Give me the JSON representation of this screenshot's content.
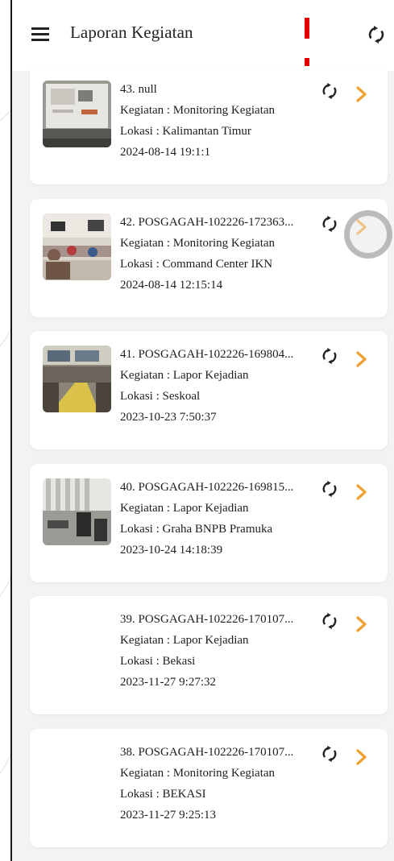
{
  "app_bar": {
    "title": "Laporan Kegiatan"
  },
  "reports": [
    {
      "title": "43. null",
      "kegiatan": "Kegiatan : Monitoring Kegiatan",
      "lokasi": "Lokasi : Kalimantan Timur",
      "tanggal": "2024-08-14 19:1:1",
      "thumb": "monitor-photo"
    },
    {
      "title": "42. POSGAGAH-102226-172363...",
      "kegiatan": "Kegiatan : Monitoring Kegiatan",
      "lokasi": "Lokasi : Command Center IKN",
      "tanggal": "2024-08-14 12:15:14",
      "thumb": "meeting-room-photo"
    },
    {
      "title": "41. POSGAGAH-102226-169804...",
      "kegiatan": "Kegiatan : Lapor Kejadian",
      "lokasi": "Lokasi : Seskoal",
      "tanggal": "2023-10-23 7:50:37",
      "thumb": "command-room-photo"
    },
    {
      "title": "40. POSGAGAH-102226-169815...",
      "kegiatan": "Kegiatan : Lapor Kejadian",
      "lokasi": "Lokasi : Graha BNPB Pramuka",
      "tanggal": "2023-10-24 14:18:39",
      "thumb": "office-photo"
    },
    {
      "title": "39. POSGAGAH-102226-170107...",
      "kegiatan": "Kegiatan : Lapor Kejadian",
      "lokasi": "Lokasi : Bekasi",
      "tanggal": "2023-11-27 9:27:32",
      "thumb": ""
    },
    {
      "title": "38. POSGAGAH-102226-170107...",
      "kegiatan": "Kegiatan : Monitoring Kegiatan",
      "lokasi": "Lokasi : BEKASI",
      "tanggal": "2023-11-27 9:25:13",
      "thumb": ""
    }
  ],
  "colors": {
    "accent": "#f0a030",
    "highlight": "#e00000",
    "card": "#ffffff",
    "background": "#f3f3f3"
  },
  "icons": {
    "menu": "hamburger-icon",
    "sync": "sync-icon",
    "open": "chevron-right-icon"
  }
}
